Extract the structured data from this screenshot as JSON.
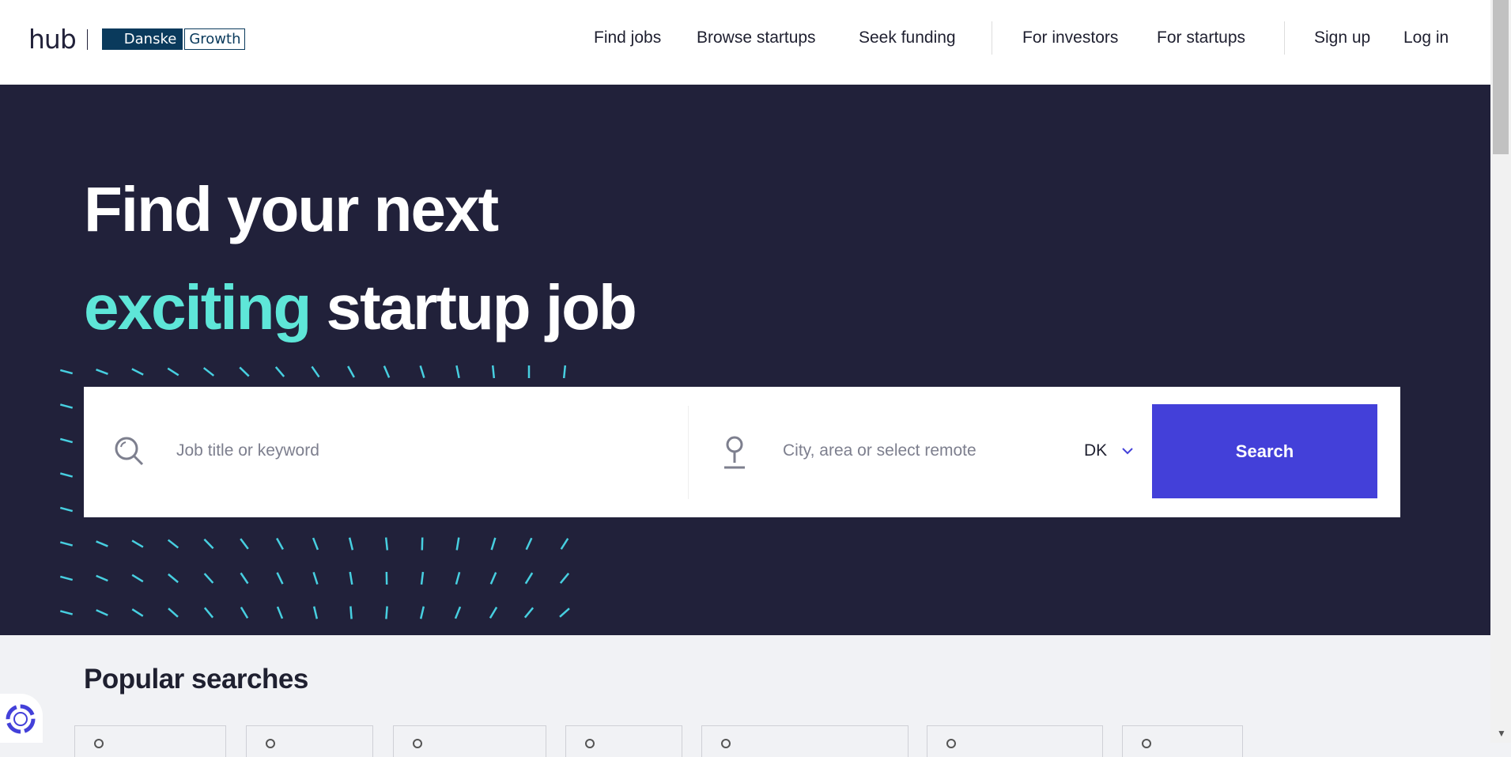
{
  "header": {
    "logo": {
      "hub": "hub",
      "danske": "Danske",
      "growth": "Growth"
    },
    "nav": [
      {
        "label": "Find jobs"
      },
      {
        "label": "Browse startups"
      },
      {
        "label": "Seek funding"
      },
      {
        "label": "For investors"
      },
      {
        "label": "For startups"
      },
      {
        "label": "Sign up"
      },
      {
        "label": "Log in"
      }
    ]
  },
  "hero": {
    "title_line1": "Find your next",
    "title_accent": "exciting",
    "title_rest": " startup job",
    "accent_color": "#5ee6d8",
    "background_color": "#21213a",
    "search": {
      "keyword_placeholder": "Job title or keyword",
      "location_placeholder": "City, area or select remote",
      "country": "DK",
      "button_label": "Search",
      "button_color": "#4340d9"
    }
  },
  "popular": {
    "title": "Popular searches",
    "chip_count_visible": 7
  }
}
